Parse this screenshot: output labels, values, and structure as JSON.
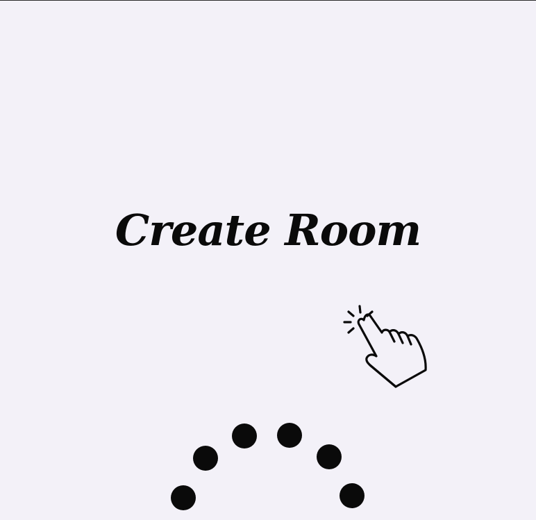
{
  "title": "Create Room",
  "icons": {
    "hand": "tap-hand-icon",
    "loader": "loading-spinner-icon"
  },
  "colors": {
    "background": "#f3f1f8",
    "ink": "#0a0a0a"
  }
}
